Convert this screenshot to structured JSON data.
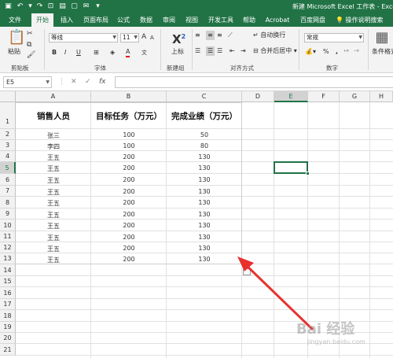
{
  "titlebar": {
    "title": "新建 Microsoft Excel 工作表 - Excel",
    "quick_access": [
      "save-icon",
      "undo-icon",
      "redo-icon",
      "print-preview-icon",
      "open-icon",
      "new-icon",
      "email-icon",
      "customize-icon"
    ]
  },
  "tabs": [
    {
      "label": "文件"
    },
    {
      "label": "开始"
    },
    {
      "label": "插入"
    },
    {
      "label": "页面布局"
    },
    {
      "label": "公式"
    },
    {
      "label": "数据"
    },
    {
      "label": "审阅"
    },
    {
      "label": "视图"
    },
    {
      "label": "开发工具"
    },
    {
      "label": "帮助"
    },
    {
      "label": "Acrobat"
    },
    {
      "label": "百度网盘"
    }
  ],
  "active_tab": "开始",
  "tell_me": "操作说明搜索",
  "ribbon": {
    "clipboard": {
      "paste": "粘贴",
      "label": "剪贴板"
    },
    "font": {
      "name": "等线",
      "size": "11",
      "bold": "B",
      "italic": "I",
      "underline": "U",
      "grow": "A",
      "shrink": "A",
      "font_color": "A",
      "label": "字体"
    },
    "new_group": {
      "superscript": "X",
      "superscript_exp": "2",
      "label": "上标",
      "group": "新建组"
    },
    "alignment": {
      "wrap": "自动换行",
      "merge": "合并后居中",
      "label": "对齐方式"
    },
    "number": {
      "format": "常规",
      "percent": "%",
      "comma": ",",
      "label": "数字"
    },
    "styles": {
      "conditional": "条件格式"
    }
  },
  "formula_bar": {
    "name_box": "E5",
    "fx": "fx",
    "content": ""
  },
  "sheet": {
    "columns": [
      "A",
      "B",
      "C",
      "D",
      "E",
      "F",
      "G",
      "H"
    ],
    "selected_column": "E",
    "rows": [
      "1",
      "2",
      "3",
      "4",
      "5",
      "6",
      "7",
      "8",
      "9",
      "10",
      "11",
      "12",
      "13",
      "14",
      "15",
      "16",
      "17",
      "18",
      "19",
      "20",
      "21"
    ],
    "selected_row": "5",
    "headers": [
      "销售人员",
      "目标任务（万元）",
      "完成业绩（万元）"
    ],
    "data": [
      [
        "张三",
        "100",
        "50"
      ],
      [
        "李四",
        "100",
        "80"
      ],
      [
        "王五",
        "200",
        "130"
      ],
      [
        "王五",
        "200",
        "130"
      ],
      [
        "王五",
        "200",
        "130"
      ],
      [
        "王五",
        "200",
        "130"
      ],
      [
        "王五",
        "200",
        "130"
      ],
      [
        "王五",
        "200",
        "130"
      ],
      [
        "王五",
        "200",
        "130"
      ],
      [
        "王五",
        "200",
        "130"
      ],
      [
        "王五",
        "200",
        "130"
      ],
      [
        "王五",
        "200",
        "130"
      ]
    ]
  },
  "annotation": {
    "arrow_color": "#e8312f"
  },
  "watermark": {
    "text": "Bai 经验",
    "url": "jingyan.baidu.com"
  },
  "colors": {
    "excel_green": "#217346",
    "ribbon_bg": "#f3f3f3"
  }
}
